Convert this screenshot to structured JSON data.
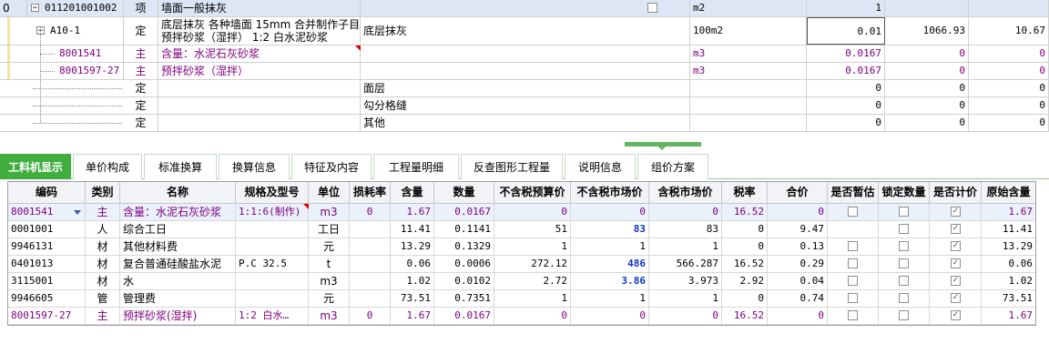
{
  "upper": {
    "rows": [
      {
        "code": "011201001002",
        "kind": "项",
        "name": "墙面一般抹灰",
        "feature": "",
        "unit": "m2",
        "qty": "1",
        "price": "",
        "total": "",
        "level": 0
      },
      {
        "code": "A10-1",
        "kind": "定",
        "name": "底层抹灰 各种墙面 15mm 合并制作子目 预拌砂浆（湿拌） 1:2 白水泥砂浆",
        "feature": "底层抹灰",
        "unit": "100m2",
        "qty": "0.01",
        "price": "1066.93",
        "total": "10.67",
        "level": 1
      },
      {
        "code": "8001541",
        "kind": "主",
        "name": "含量：水泥石灰砂浆",
        "feature": "",
        "unit": "m3",
        "qty": "0.0167",
        "price": "0",
        "total": "0",
        "level": 2
      },
      {
        "code": "8001597-27",
        "kind": "主",
        "name": "预拌砂浆（湿拌）",
        "feature": "",
        "unit": "m3",
        "qty": "0.0167",
        "price": "0",
        "total": "0",
        "level": 2
      },
      {
        "code": "",
        "kind": "定",
        "name": "",
        "feature": "面层",
        "unit": "",
        "qty": "0",
        "price": "0",
        "total": "0",
        "level": 2
      },
      {
        "code": "",
        "kind": "定",
        "name": "",
        "feature": "勾分格缝",
        "unit": "",
        "qty": "0",
        "price": "0",
        "total": "0",
        "level": 2
      },
      {
        "code": "",
        "kind": "定",
        "name": "",
        "feature": "其他",
        "unit": "",
        "qty": "0",
        "price": "0",
        "total": "0",
        "level": 2
      }
    ],
    "row_prefix_0": "0",
    "a10_name_line1": "底层抹灰 各种墙面 15mm  合并制作子目",
    "a10_name_line2": "预拌砂浆（湿拌） 1:2 白水泥砂浆"
  },
  "tabs": [
    {
      "label": "工料机显示",
      "active": true
    },
    {
      "label": "单价构成",
      "active": false
    },
    {
      "label": "标准换算",
      "active": false
    },
    {
      "label": "换算信息",
      "active": false
    },
    {
      "label": "特征及内容",
      "active": false
    },
    {
      "label": "工程量明细",
      "active": false
    },
    {
      "label": "反查图形工程量",
      "active": false
    },
    {
      "label": "说明信息",
      "active": false
    },
    {
      "label": "组价方案",
      "active": false
    }
  ],
  "lower": {
    "headers": [
      "编码",
      "类别",
      "名称",
      "规格及型号",
      "单位",
      "损耗率",
      "含量",
      "数量",
      "不含税预算价",
      "不含税市场价",
      "含税市场价",
      "税率",
      "合价",
      "是否暂估",
      "锁定数量",
      "是否计价",
      "原始含量"
    ],
    "rows": [
      {
        "code": "8001541",
        "kind": "主",
        "name": "含量：水泥石灰砂浆",
        "spec": "1:1:6(制作)",
        "unit": "m3",
        "loss": "0",
        "content": "1.67",
        "qty": "0.0167",
        "budget": "0",
        "market": "0",
        "taxmarket": "0",
        "tax": "16.52",
        "total": "0",
        "est": false,
        "lock": false,
        "price": true,
        "orig": "1.67",
        "purple": true,
        "selected": true
      },
      {
        "code": "0001001",
        "kind": "人",
        "name": "综合工日",
        "spec": "",
        "unit": "工日",
        "loss": "",
        "content": "11.41",
        "qty": "0.1141",
        "budget": "51",
        "market": "83",
        "taxmarket": "83",
        "tax": "0",
        "total": "9.47",
        "est": null,
        "lock": false,
        "price": true,
        "orig": "11.41",
        "purple": false,
        "blue": true
      },
      {
        "code": "9946131",
        "kind": "材",
        "name": "其他材料费",
        "spec": "",
        "unit": "元",
        "loss": "",
        "content": "13.29",
        "qty": "0.1329",
        "budget": "1",
        "market": "1",
        "taxmarket": "1",
        "tax": "0",
        "total": "0.13",
        "est": false,
        "lock": false,
        "price": true,
        "orig": "13.29",
        "purple": false
      },
      {
        "code": "0401013",
        "kind": "材",
        "name": "复合普通硅酸盐水泥",
        "spec": "P.C 32.5",
        "unit": "t",
        "loss": "",
        "content": "0.06",
        "qty": "0.0006",
        "budget": "272.12",
        "market": "486",
        "taxmarket": "566.287",
        "tax": "16.52",
        "total": "0.29",
        "est": false,
        "lock": false,
        "price": true,
        "orig": "0.06",
        "purple": false,
        "blue": true
      },
      {
        "code": "3115001",
        "kind": "材",
        "name": "水",
        "spec": "",
        "unit": "m3",
        "loss": "",
        "content": "1.02",
        "qty": "0.0102",
        "budget": "2.72",
        "market": "3.86",
        "taxmarket": "3.973",
        "tax": "2.92",
        "total": "0.04",
        "est": false,
        "lock": false,
        "price": true,
        "orig": "1.02",
        "purple": false,
        "blue": true
      },
      {
        "code": "9946605",
        "kind": "管",
        "name": "管理费",
        "spec": "",
        "unit": "元",
        "loss": "",
        "content": "73.51",
        "qty": "0.7351",
        "budget": "1",
        "market": "1",
        "taxmarket": "1",
        "tax": "0",
        "total": "0.74",
        "est": false,
        "lock": false,
        "price": true,
        "orig": "73.51",
        "purple": false
      },
      {
        "code": "8001597-27",
        "kind": "主",
        "name": "预拌砂浆(湿拌)",
        "spec": "1:2 白水…",
        "unit": "m3",
        "loss": "0",
        "content": "1.67",
        "qty": "0.0167",
        "budget": "0",
        "market": "0",
        "taxmarket": "0",
        "tax": "16.52",
        "total": "0",
        "est": false,
        "lock": false,
        "price": true,
        "orig": "1.67",
        "purple": true
      }
    ]
  }
}
